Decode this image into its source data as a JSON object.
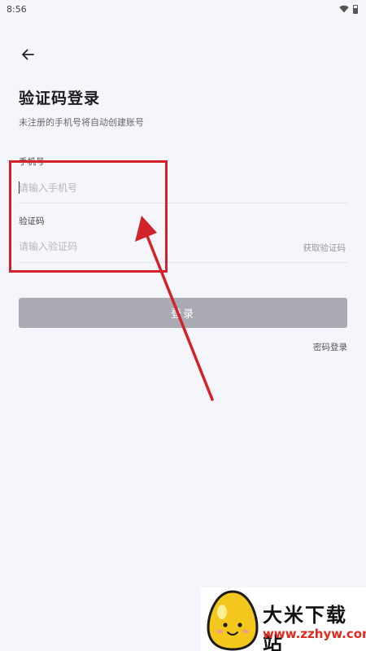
{
  "status_bar": {
    "time": "8:56"
  },
  "header": {
    "title": "验证码登录",
    "subtitle": "未注册的手机号将自动创建账号"
  },
  "phone_field": {
    "label": "手机号",
    "placeholder": "请输入手机号",
    "value": ""
  },
  "code_field": {
    "label": "验证码",
    "placeholder": "请输入验证码",
    "value": "",
    "get_code_label": "获取验证码"
  },
  "login_button": {
    "label": "登录",
    "enabled": false
  },
  "password_login_label": "密码登录",
  "watermark": {
    "title": "大米下载站",
    "url": "www.zzhyw.com"
  },
  "colors": {
    "background": "#f5f6fb",
    "button_disabled": "#aaabb2",
    "annotation": "#d3232a",
    "watermark_url": "#e12a1e"
  },
  "icons": {
    "back": "arrow-left-icon",
    "wifi": "wifi-icon",
    "battery": "battery-icon",
    "logo": "egg-mascot-icon"
  }
}
